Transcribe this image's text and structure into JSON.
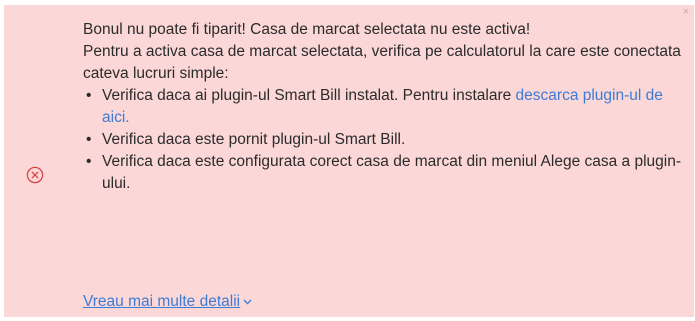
{
  "alert": {
    "close_glyph": "×",
    "icon": "error-circle-x-icon",
    "colors": {
      "background": "#fcd7d7",
      "icon": "#d94545",
      "link": "#3d7bd4",
      "text": "#2b2b2b"
    },
    "line1": "Bonul nu poate fi tiparit! Casa de marcat selectata nu este activa!",
    "line2": "Pentru a activa casa de marcat selectata, verifica pe calculatorul la care este conectata cateva lucruri simple:",
    "items": [
      {
        "text": "Verifica daca ai plugin-ul Smart Bill instalat. Pentru instalare ",
        "link": "descarca plugin-ul de aici."
      },
      {
        "text": "Verifica daca este pornit plugin-ul Smart Bill."
      },
      {
        "text": "Verifica daca este configurata corect casa de marcat din meniul Alege casa a plugin-ului."
      }
    ],
    "details_link": "Vreau mai multe detalii",
    "details_icon": "chevron-down-icon"
  }
}
